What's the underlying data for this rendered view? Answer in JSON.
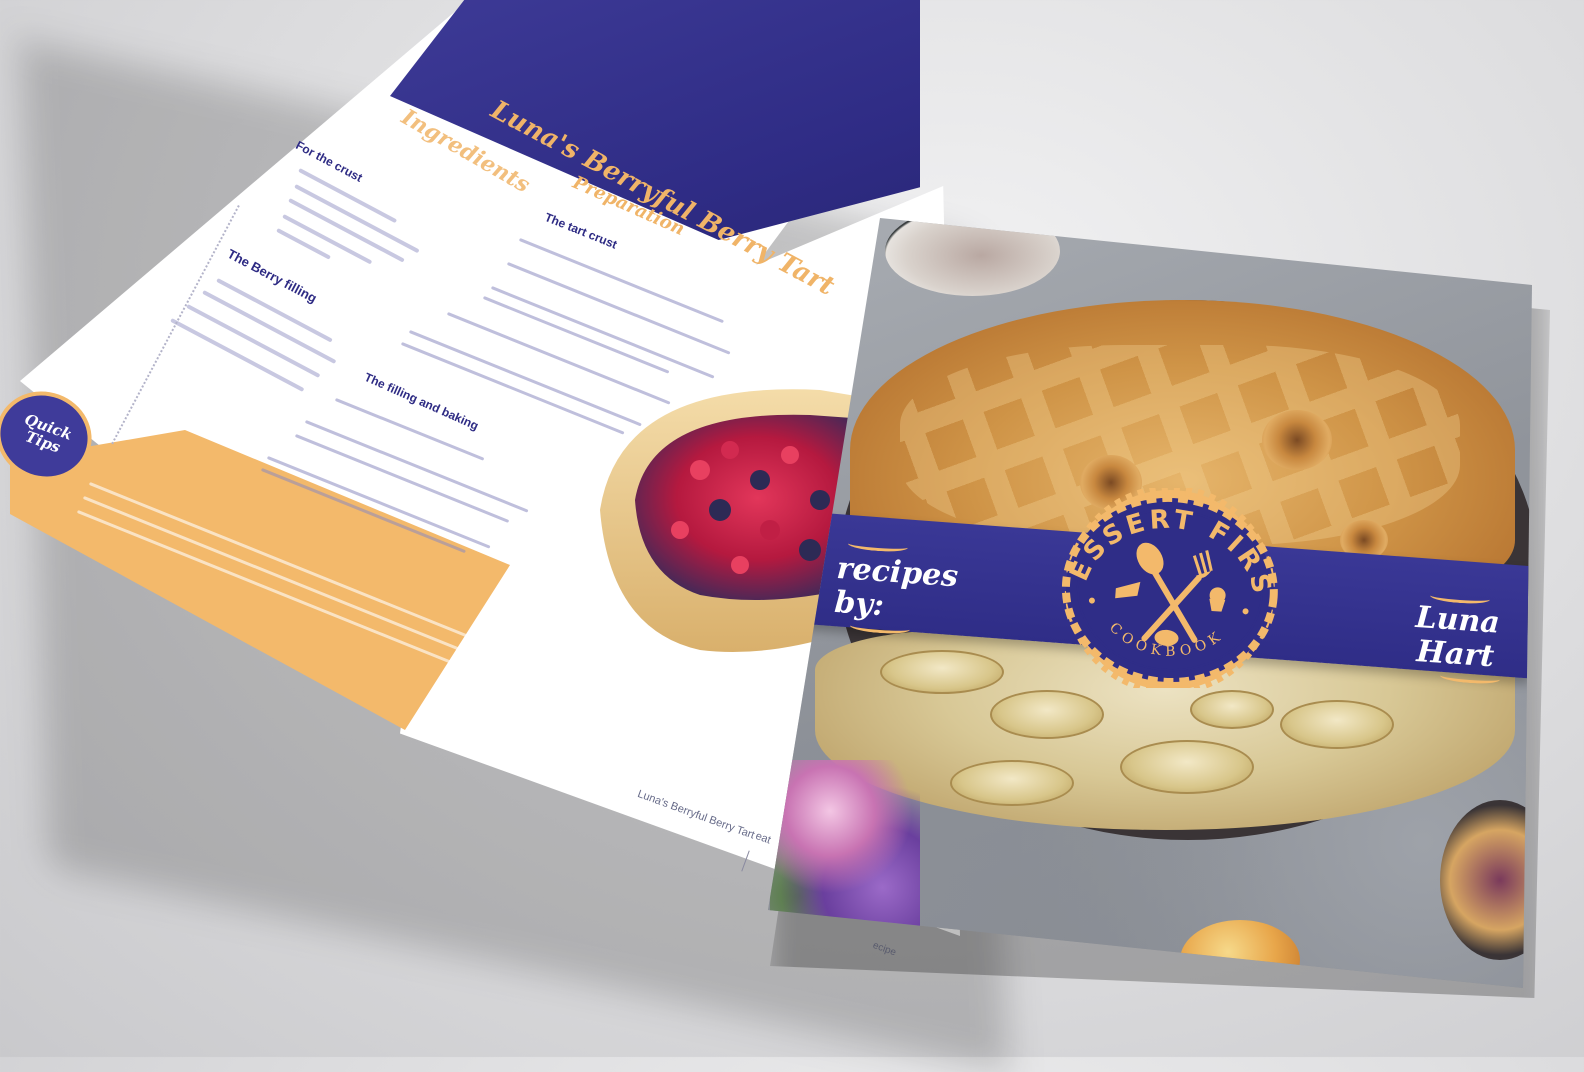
{
  "magazine": {
    "recipe_title": "Luna's Berryful Berry Tart",
    "ingredients_heading": "Ingredients",
    "preparation_heading": "Preparation",
    "ingredients_sub_1": "For the crust",
    "ingredients_sub_2": "The Berry filling",
    "prep_sub_1": "The tart crust",
    "prep_sub_2": "The filling and baking",
    "quick_tips_line1": "Quick",
    "quick_tips_line2": "Tips",
    "footer_title": "Luna's Berryful Berry Tart",
    "footer_site": "eat",
    "footer_tail": "ecipe"
  },
  "cover": {
    "recipes_line1": "recipes",
    "recipes_line2": "by:",
    "author_line1": "Luna",
    "author_line2": "Hart",
    "badge_title": "DESSERT FIRST",
    "badge_subtitle": "COOKBOOK"
  },
  "colors": {
    "navy": "#2f2d87",
    "gold": "#f3b96b",
    "page": "#ffffff"
  },
  "icons": [
    "spoon-icon",
    "fork-icon",
    "cake-slice-icon",
    "cupcake-icon",
    "bun-icon"
  ]
}
